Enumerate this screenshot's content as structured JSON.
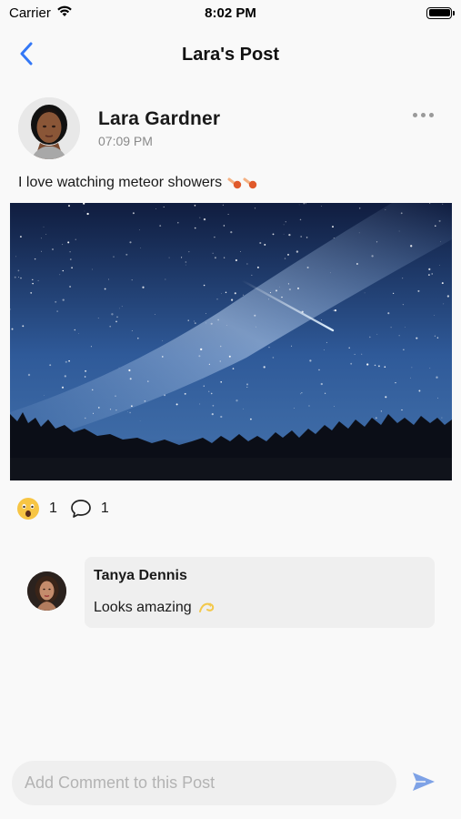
{
  "status_bar": {
    "carrier": "Carrier",
    "time": "8:02 PM",
    "battery_level": 1.0
  },
  "nav": {
    "title": "Lara's Post",
    "back_icon": "chevron-left-icon"
  },
  "post": {
    "author": "Lara Gardner",
    "time": "07:09 PM",
    "text": "I love watching meteor showers",
    "text_emoji": "meteor-emoji",
    "image": "starry-night-sky-with-meteor",
    "more_icon": "more-horizontal-icon",
    "reactions": {
      "emoji": "astonished-face-emoji",
      "reaction_count": "1",
      "comment_count": "1",
      "comment_icon": "speech-bubble-icon"
    }
  },
  "comments": [
    {
      "author": "Tanya Dennis",
      "text": "Looks amazing",
      "emoji": "dizzy-emoji"
    }
  ],
  "composer": {
    "placeholder": "Add Comment to this Post",
    "value": "",
    "send_icon": "send-icon"
  },
  "colors": {
    "accent": "#3478f6",
    "background": "#f9f9f9",
    "bubble": "#efefef",
    "muted_text": "#8a8a8a",
    "send": "#7ea2e6"
  }
}
